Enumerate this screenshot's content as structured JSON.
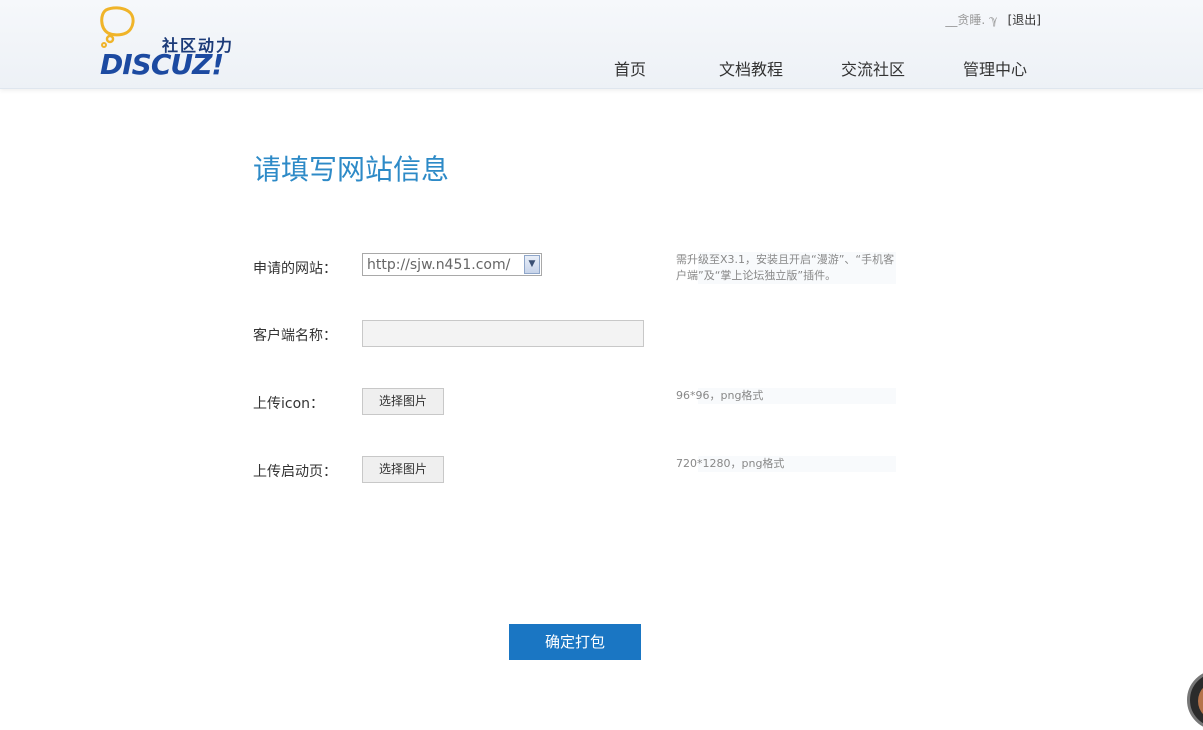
{
  "header": {
    "logo": {
      "cn_text": "社区动力",
      "en_text": "DISCUZ",
      "en_suffix": "!"
    },
    "user": {
      "name": "__贪睡. ℽ",
      "logout_label": "[退出]"
    },
    "nav": [
      {
        "label": "首页"
      },
      {
        "label": "文档教程"
      },
      {
        "label": "交流社区"
      },
      {
        "label": "管理中心"
      }
    ]
  },
  "main": {
    "title": "请填写网站信息",
    "fields": {
      "site": {
        "label": "申请的网站：",
        "selected": "http://sjw.n451.com/",
        "hint": "需升级至X3.1，安装且开启“漫游”、“手机客户端”及“掌上论坛独立版”插件。"
      },
      "client_name": {
        "label": "客户端名称：",
        "value": ""
      },
      "icon": {
        "label": "上传icon：",
        "button": "选择图片",
        "hint": "96*96，png格式"
      },
      "splash": {
        "label": "上传启动页：",
        "button": "选择图片",
        "hint": "720*1280，png格式"
      }
    },
    "submit_label": "确定打包"
  },
  "colors": {
    "accent": "#2d8ac7",
    "button": "#1a76c3",
    "logo": "#1c4aa1"
  }
}
